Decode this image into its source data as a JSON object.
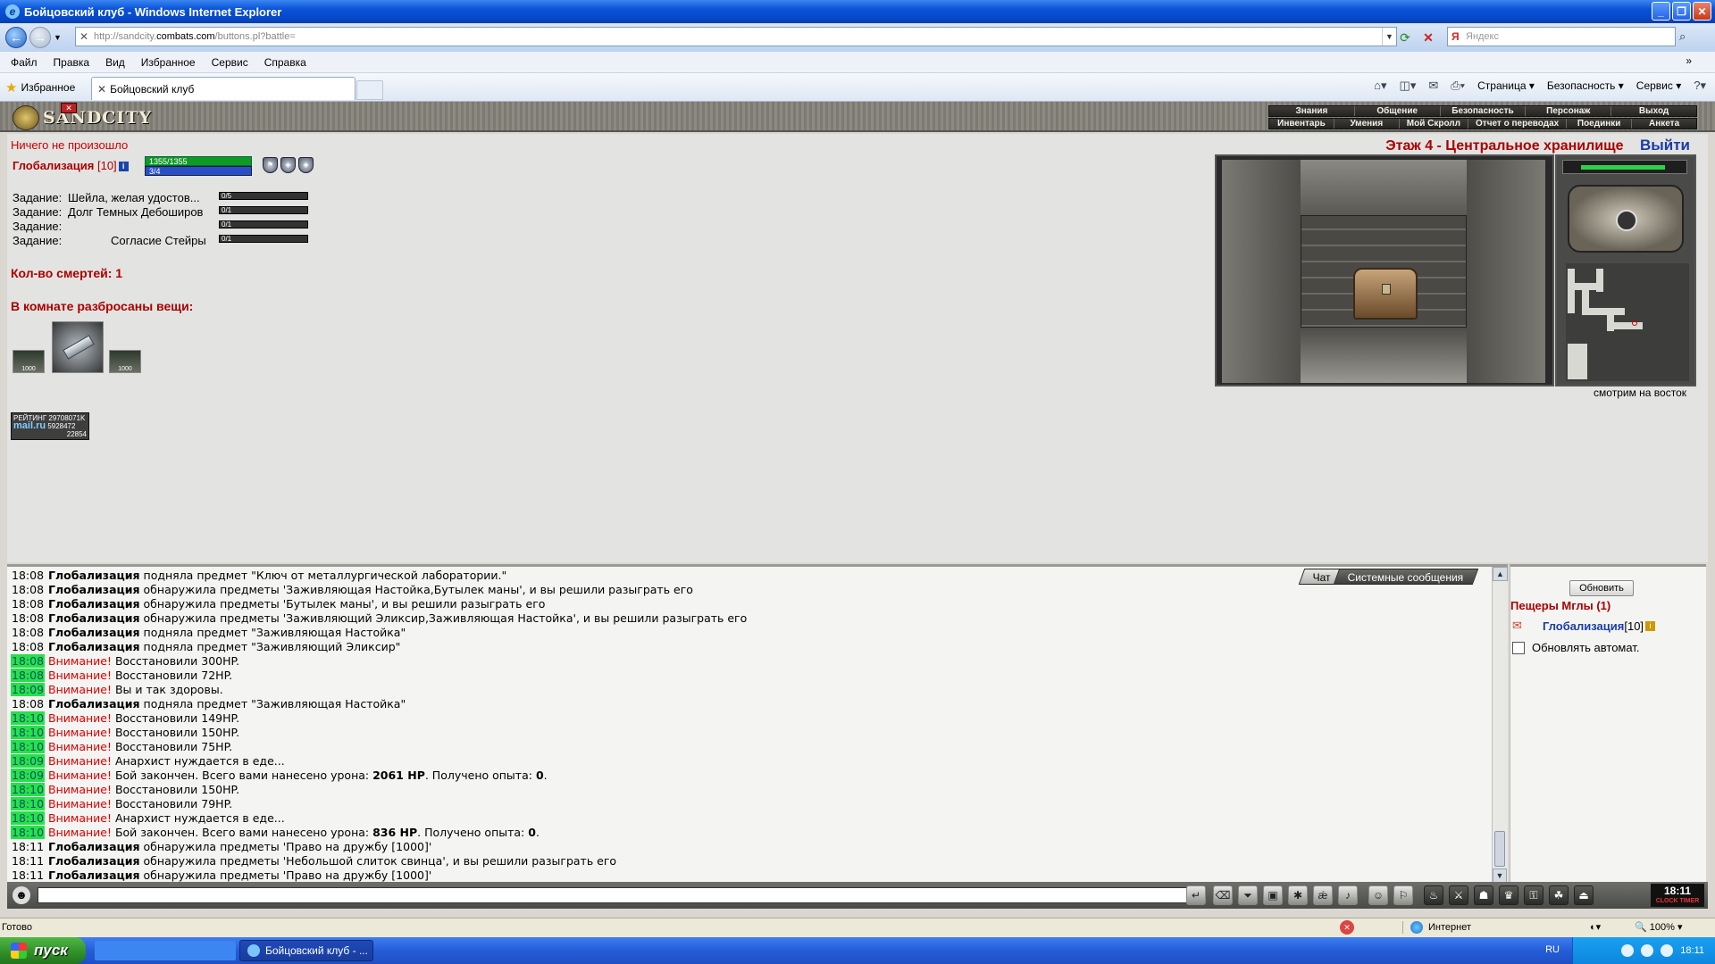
{
  "window": {
    "title": "Бойцовский клуб - Windows Internet Explorer",
    "url_prefix": "http://sandcity.",
    "url_domain": "combats.com",
    "url_suffix": "/buttons.pl?battle=",
    "search_placeholder": "Яндекс"
  },
  "menu": [
    "Файл",
    "Правка",
    "Вид",
    "Избранное",
    "Сервис",
    "Справка"
  ],
  "favorites_label": "Избранное",
  "tab_title": "Бойцовский клуб",
  "commands": {
    "page": "Страница",
    "security": "Безопасность",
    "service": "Сервис"
  },
  "game": {
    "logo_text": "SANDCITY",
    "nav_top": [
      "Знания",
      "Общение",
      "Безопасность",
      "Персонаж",
      "Выход"
    ],
    "nav_bottom": [
      "Инвентарь",
      "Умения",
      "Мой Скролл",
      "Отчет о переводах",
      "Поединки",
      "Анкета"
    ],
    "status_line": "Ничего не произошло",
    "char_name": "Глобализация",
    "char_level": "[10]",
    "hp": "1355/1355",
    "mp": "3/4",
    "tasks": [
      {
        "label": "Задание:",
        "text": "Шейла, желая удостов...",
        "progress": "0/5"
      },
      {
        "label": "Задание:",
        "text": "Долг Темных Дебоширов",
        "progress": "0/1"
      },
      {
        "label": "Задание:",
        "text": "",
        "progress": "0/1"
      },
      {
        "label": "Задание:",
        "text": "Согласие Стейры",
        "progress": "0/1"
      }
    ],
    "deaths": "Кол-во смертей: 1",
    "room_items_title": "В комнате разбросаны вещи:",
    "item_small_label": "1000",
    "counter_line1": "РЕЙТИНГ 29708071K",
    "counter_logo": "mail.ru",
    "counter_line2": "5928472",
    "counter_line3": "22854",
    "location": "Этаж 4 - Центральное хранилище",
    "exit": "Выйти",
    "view_caption": "смотрим на восток"
  },
  "chat": {
    "tabs": [
      "Чат",
      "Системные сообщения"
    ],
    "lines": [
      {
        "time": "18:08",
        "green": false,
        "warn": "",
        "name": "Глобализация",
        "text": " подняла предмет \"Ключ от металлургической лаборатории.\"",
        "bold1": "",
        "mid": "",
        "bold2": "",
        "end": ""
      },
      {
        "time": "18:08",
        "green": false,
        "warn": "",
        "name": "Глобализация",
        "text": " обнаружила предметы 'Заживляющая Настойка,Бутылек маны', и вы решили разыграть его",
        "bold1": "",
        "mid": "",
        "bold2": "",
        "end": ""
      },
      {
        "time": "18:08",
        "green": false,
        "warn": "",
        "name": "Глобализация",
        "text": " обнаружила предметы 'Бутылек маны', и вы решили разыграть его",
        "bold1": "",
        "mid": "",
        "bold2": "",
        "end": ""
      },
      {
        "time": "18:08",
        "green": false,
        "warn": "",
        "name": "Глобализация",
        "text": " обнаружила предметы 'Заживляющий Эликсир,Заживляющая Настойка', и вы решили разыграть его",
        "bold1": "",
        "mid": "",
        "bold2": "",
        "end": ""
      },
      {
        "time": "18:08",
        "green": false,
        "warn": "",
        "name": "Глобализация",
        "text": " подняла предмет \"Заживляющая Настойка\"",
        "bold1": "",
        "mid": "",
        "bold2": "",
        "end": ""
      },
      {
        "time": "18:08",
        "green": false,
        "warn": "",
        "name": "Глобализация",
        "text": " подняла предмет \"Заживляющий Эликсир\"",
        "bold1": "",
        "mid": "",
        "bold2": "",
        "end": ""
      },
      {
        "time": "18:08",
        "green": true,
        "warn": "Внимание!",
        "name": "",
        "text": " Восстановили 300HP.",
        "bold1": "",
        "mid": "",
        "bold2": "",
        "end": ""
      },
      {
        "time": "18:08",
        "green": true,
        "warn": "Внимание!",
        "name": "",
        "text": " Восстановили 72HP.",
        "bold1": "",
        "mid": "",
        "bold2": "",
        "end": ""
      },
      {
        "time": "18:09",
        "green": true,
        "warn": "Внимание!",
        "name": "",
        "text": " Вы и так здоровы.",
        "bold1": "",
        "mid": "",
        "bold2": "",
        "end": ""
      },
      {
        "time": "18:08",
        "green": false,
        "warn": "",
        "name": "Глобализация",
        "text": " подняла предмет \"Заживляющая Настойка\"",
        "bold1": "",
        "mid": "",
        "bold2": "",
        "end": ""
      },
      {
        "time": "18:10",
        "green": true,
        "warn": "Внимание!",
        "name": "",
        "text": " Восстановили 149HP.",
        "bold1": "",
        "mid": "",
        "bold2": "",
        "end": ""
      },
      {
        "time": "18:10",
        "green": true,
        "warn": "Внимание!",
        "name": "",
        "text": " Восстановили 150HP.",
        "bold1": "",
        "mid": "",
        "bold2": "",
        "end": ""
      },
      {
        "time": "18:10",
        "green": true,
        "warn": "Внимание!",
        "name": "",
        "text": " Восстановили 75HP.",
        "bold1": "",
        "mid": "",
        "bold2": "",
        "end": ""
      },
      {
        "time": "18:09",
        "green": true,
        "warn": "Внимание!",
        "name": "",
        "text": " Анархист нуждается в еде...",
        "bold1": "",
        "mid": "",
        "bold2": "",
        "end": ""
      },
      {
        "time": "18:09",
        "green": true,
        "warn": "Внимание!",
        "name": "",
        "text": " Бой закончен. Всего вами нанесено урона: ",
        "bold1": "2061 HP",
        "mid": ". Получено опыта: ",
        "bold2": "0",
        "end": "."
      },
      {
        "time": "18:10",
        "green": true,
        "warn": "Внимание!",
        "name": "",
        "text": " Восстановили 150HP.",
        "bold1": "",
        "mid": "",
        "bold2": "",
        "end": ""
      },
      {
        "time": "18:10",
        "green": true,
        "warn": "Внимание!",
        "name": "",
        "text": " Восстановили 79HP.",
        "bold1": "",
        "mid": "",
        "bold2": "",
        "end": ""
      },
      {
        "time": "18:10",
        "green": true,
        "warn": "Внимание!",
        "name": "",
        "text": " Анархист нуждается в еде...",
        "bold1": "",
        "mid": "",
        "bold2": "",
        "end": ""
      },
      {
        "time": "18:10",
        "green": true,
        "warn": "Внимание!",
        "name": "",
        "text": " Бой закончен. Всего вами нанесено урона: ",
        "bold1": "836 HP",
        "mid": ". Получено опыта: ",
        "bold2": "0",
        "end": "."
      },
      {
        "time": "18:11",
        "green": false,
        "warn": "",
        "name": "Глобализация",
        "text": " обнаружила предметы 'Право на дружбу [1000]'",
        "bold1": "",
        "mid": "",
        "bold2": "",
        "end": ""
      },
      {
        "time": "18:11",
        "green": false,
        "warn": "",
        "name": "Глобализация",
        "text": " обнаружила предметы 'Небольшой слиток свинца', и вы решили разыграть его",
        "bold1": "",
        "mid": "",
        "bold2": "",
        "end": ""
      },
      {
        "time": "18:11",
        "green": false,
        "warn": "",
        "name": "Глобализация",
        "text": " обнаружила предметы 'Право на дружбу [1000]'",
        "bold1": "",
        "mid": "",
        "bold2": "",
        "end": ""
      }
    ]
  },
  "online": {
    "refresh": "Обновить",
    "room": "Пещеры Мглы (1)",
    "user": "Глобализация",
    "user_level": "[10]",
    "auto_refresh": "Обновлять автомат."
  },
  "clock": {
    "time": "18:11",
    "label": "CLOCK TIMER"
  },
  "statusbar": {
    "ready": "Готово",
    "zone": "Интернет",
    "zoom": "100%"
  },
  "taskbar": {
    "start": "пуск",
    "ie_task": "Бойцовский клуб - ...",
    "lang": "RU",
    "time": "18:11"
  }
}
